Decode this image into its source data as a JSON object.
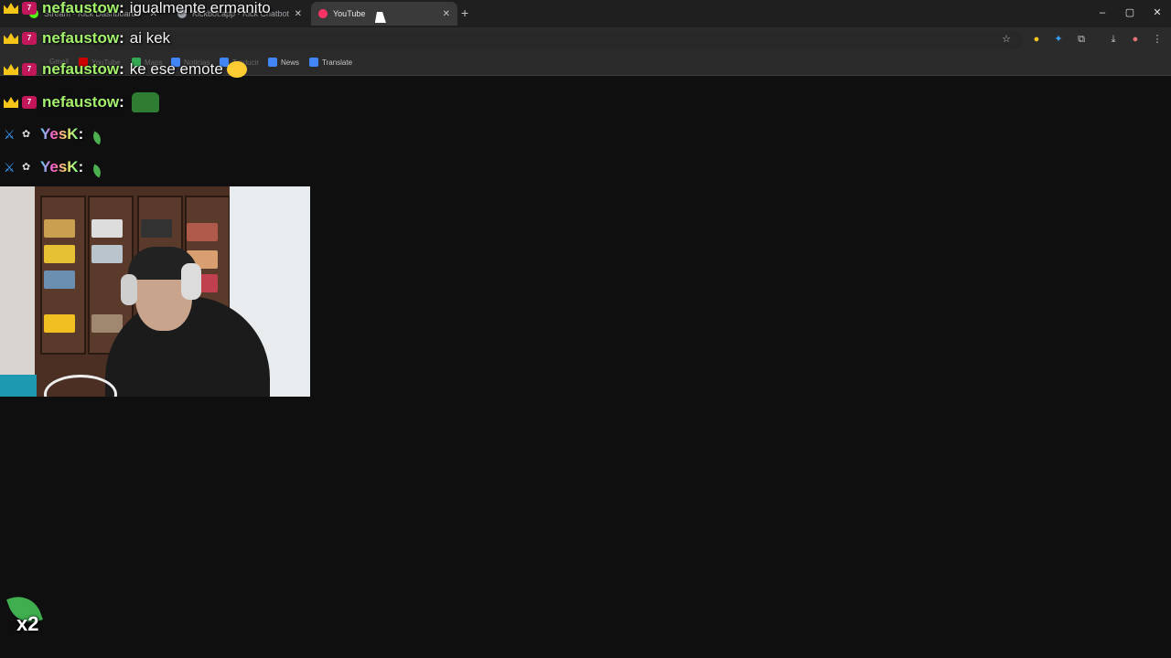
{
  "browser": {
    "tabs": [
      {
        "label": "Stream - Kick Dashboard",
        "favicon_color": "#53fc18",
        "active": false
      },
      {
        "label": "Kickbot.app - Kick Chatbot and",
        "favicon_color": "#9aa0a6",
        "active": false
      },
      {
        "label": "YouTube",
        "favicon_color": "#ff3366",
        "active": true
      }
    ],
    "new_tab_glyph": "+",
    "window_buttons": [
      "–",
      "▢",
      "✕"
    ],
    "bookmarks": [
      {
        "label": "Gmail",
        "color": "#888",
        "dim": true
      },
      {
        "label": "YouTube",
        "color": "#cc0000",
        "dim": true
      },
      {
        "label": "Maps",
        "color": "#34a853",
        "dim": true
      },
      {
        "label": "Noticias",
        "color": "#4285f4",
        "dim": true
      },
      {
        "label": "Traducir",
        "color": "#4285f4",
        "dim": true
      },
      {
        "label": "News",
        "color": "#4285f4",
        "dim": false
      },
      {
        "label": "Translate",
        "color": "#4285f4",
        "dim": false
      }
    ]
  },
  "chat": {
    "messages": [
      {
        "user": "nefaustow",
        "badges": [
          "crown",
          "7tv"
        ],
        "text": "igualmente ermanito",
        "emote": null
      },
      {
        "user": "nefaustow",
        "badges": [
          "crown",
          "7tv"
        ],
        "text": "ai kek",
        "emote": null
      },
      {
        "user": "nefaustow",
        "badges": [
          "crown",
          "7tv"
        ],
        "text": "ke ese emote",
        "emote": "face"
      },
      {
        "user": "nefaustow",
        "badges": [
          "crown",
          "7tv"
        ],
        "text": "",
        "emote": "green-box"
      },
      {
        "user": "YesK",
        "badges": [
          "sword",
          "small"
        ],
        "text": "",
        "emote": "leaf"
      },
      {
        "user": "YesK",
        "badges": [
          "sword",
          "small"
        ],
        "text": "",
        "emote": "leaf"
      }
    ]
  },
  "combo": {
    "count": "x2",
    "emote": "leaf"
  }
}
